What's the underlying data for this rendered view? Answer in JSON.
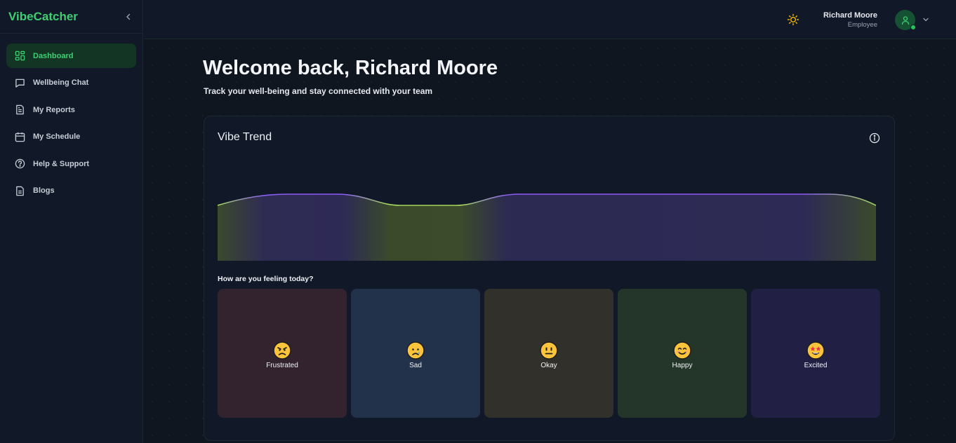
{
  "app": {
    "name": "VibeCatcher"
  },
  "sidebar": {
    "items": [
      {
        "label": "Dashboard",
        "icon": "dashboard-icon",
        "active": true
      },
      {
        "label": "Wellbeing Chat",
        "icon": "chat-icon"
      },
      {
        "label": "My Reports",
        "icon": "report-icon"
      },
      {
        "label": "My Schedule",
        "icon": "calendar-icon"
      },
      {
        "label": "Help & Support",
        "icon": "help-icon"
      },
      {
        "label": "Blogs",
        "icon": "blog-icon"
      }
    ]
  },
  "header": {
    "theme_icon": "sun-icon",
    "user": {
      "name": "Richard Moore",
      "role": "Employee"
    }
  },
  "main": {
    "welcome": "Welcome back, Richard Moore",
    "subtitle": "Track your well-being and stay connected with your team",
    "vibe_trend": {
      "title": "Vibe Trend"
    },
    "mood_question": "How are you feeling today?",
    "moods": [
      {
        "label": "Frustrated",
        "emoji": "😠",
        "bg": "#33232f"
      },
      {
        "label": "Sad",
        "emoji": "😢",
        "bg": "#22324a"
      },
      {
        "label": "Okay",
        "emoji": "😐",
        "bg": "#32302a"
      },
      {
        "label": "Happy",
        "emoji": "😊",
        "bg": "#24362a"
      },
      {
        "label": "Excited",
        "emoji": "🤩",
        "bg": "#211f44"
      }
    ]
  },
  "colors": {
    "accent": "#3ecf73",
    "trend_high": "#8b5cf6",
    "trend_low": "#a3d65c"
  }
}
